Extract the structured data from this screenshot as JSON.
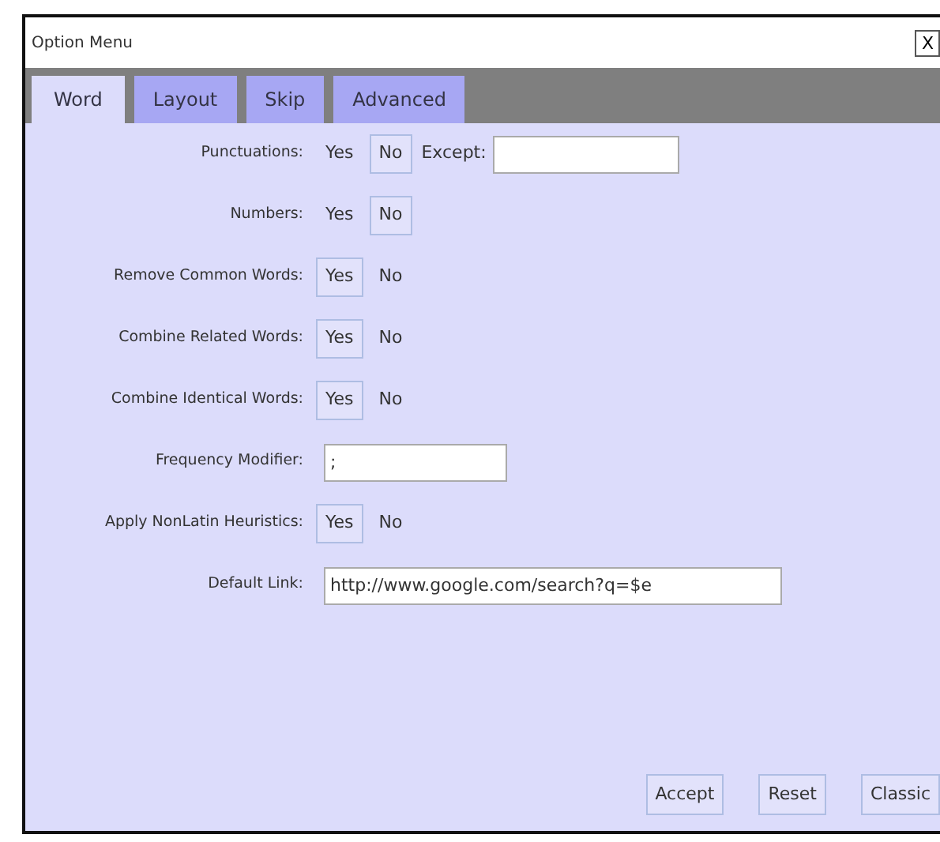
{
  "window": {
    "title": "Option Menu",
    "close": "X"
  },
  "tabs": [
    {
      "label": "Word",
      "selected": true
    },
    {
      "label": "Layout",
      "selected": false
    },
    {
      "label": "Skip",
      "selected": false
    },
    {
      "label": "Advanced",
      "selected": false
    }
  ],
  "settings": [
    {
      "label": "Punctuations:",
      "kind": "toggle",
      "options": [
        {
          "label": "Yes",
          "selected": false
        },
        {
          "label": "No",
          "selected": true
        }
      ],
      "extra": {
        "label": "Except:"
      }
    },
    {
      "label": "Numbers:",
      "kind": "toggle",
      "options": [
        {
          "label": "Yes",
          "selected": false
        },
        {
          "label": "No",
          "selected": true
        }
      ]
    },
    {
      "label": "Remove Common Words:",
      "kind": "toggle",
      "options": [
        {
          "label": "Yes",
          "selected": true
        },
        {
          "label": "No",
          "selected": false
        }
      ]
    },
    {
      "label": "Combine Related Words:",
      "kind": "toggle",
      "options": [
        {
          "label": "Yes",
          "selected": true
        },
        {
          "label": "No",
          "selected": false
        }
      ]
    },
    {
      "label": "Combine Identical Words:",
      "kind": "toggle",
      "options": [
        {
          "label": "Yes",
          "selected": true
        },
        {
          "label": "No",
          "selected": false
        }
      ]
    },
    {
      "label": "Frequency Modifier:",
      "kind": "text",
      "value": ";"
    },
    {
      "label": "Apply NonLatin Heuristics:",
      "kind": "toggle",
      "options": [
        {
          "label": "Yes",
          "selected": true
        },
        {
          "label": "No",
          "selected": false
        }
      ]
    },
    {
      "label": "Default Link:",
      "kind": "wide-text",
      "value": "http://www.google.com/search?q=$e"
    }
  ],
  "buttons": [
    "Accept",
    "Reset",
    "Classic"
  ]
}
